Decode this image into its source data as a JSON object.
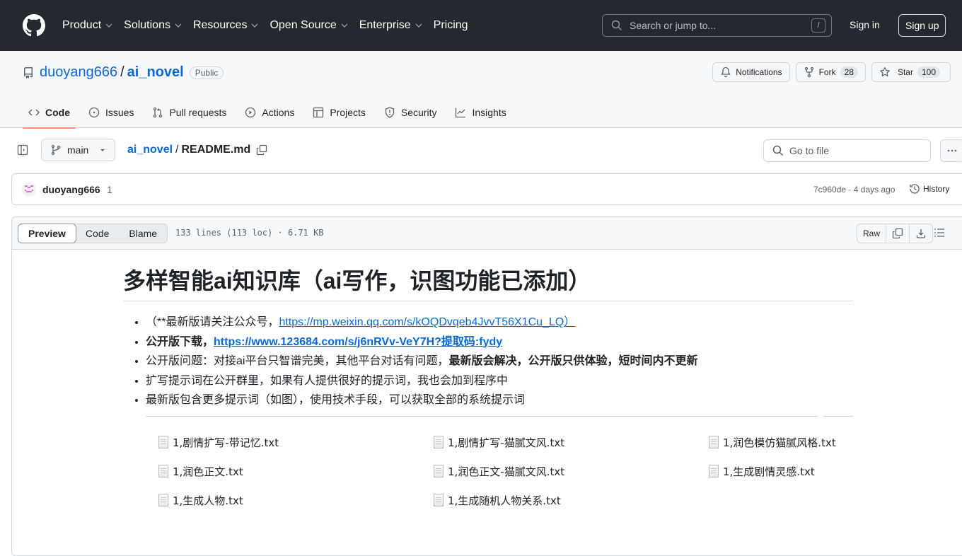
{
  "header": {
    "nav": [
      "Product",
      "Solutions",
      "Resources",
      "Open Source",
      "Enterprise",
      "Pricing"
    ],
    "nav_has_dropdown": [
      true,
      true,
      true,
      true,
      true,
      false
    ],
    "search_placeholder": "Search or jump to...",
    "search_shortcut": "/",
    "sign_in": "Sign in",
    "sign_up": "Sign up"
  },
  "repo": {
    "owner": "duoyang666",
    "separator": "/",
    "name": "ai_novel",
    "visibility": "Public",
    "notifications_label": "Notifications",
    "fork_label": "Fork",
    "fork_count": "28",
    "star_label": "Star",
    "star_count": "100",
    "tabs": [
      {
        "label": "Code",
        "icon": "code-icon",
        "active": true
      },
      {
        "label": "Issues",
        "icon": "issue-icon"
      },
      {
        "label": "Pull requests",
        "icon": "pull-request-icon"
      },
      {
        "label": "Actions",
        "icon": "play-icon"
      },
      {
        "label": "Projects",
        "icon": "table-icon"
      },
      {
        "label": "Security",
        "icon": "shield-icon"
      },
      {
        "label": "Insights",
        "icon": "graph-icon"
      }
    ]
  },
  "file_nav": {
    "branch": "main",
    "crumb_repo": "ai_novel",
    "crumb_sep": "/",
    "crumb_file": "README.md",
    "goto_placeholder": "Go to file"
  },
  "commit": {
    "author": "duoyang666",
    "count": "1",
    "meta": "7c960de · 4 days ago",
    "history": "History"
  },
  "file": {
    "view_tabs": [
      "Preview",
      "Code",
      "Blame"
    ],
    "active_view": "Preview",
    "info": "133 lines (113 loc) · 6.71 KB",
    "raw": "Raw"
  },
  "readme": {
    "title": "多样智能ai知识库（ai写作，识图功能已添加）",
    "items": [
      {
        "prefix": "（**最新版请关注公众号，",
        "link": "https://mp.weixin.qq.com/s/kOQDvqeb4JvvT56X1Cu_LQ）",
        "bold": false
      },
      {
        "prefix": "公开版下载，",
        "link": "https://www.123684.com/s/j6nRVv-VeY7H?提取码:fydy",
        "bold": true
      },
      {
        "prefix": "公开版问题：对接ai平台只智谱完美，其他平台对话有问题，",
        "suffix_bold": "最新版会解决，公开版只供体验，短时间内不更新"
      },
      {
        "prefix": "扩写提示词在公开群里，如果有人提供很好的提示词，我也会加到程序中"
      },
      {
        "prefix": "最新版包含更多提示词（如图），使用技术手段，可以获取全部的系统提示词"
      }
    ],
    "image_files": [
      "1,剧情扩写-带记忆.txt",
      "1,剧情扩写-猫腻文风.txt",
      "1,润色模仿猫腻风格.txt",
      "1,润色正文.txt",
      "1,润色正文-猫腻文风.txt",
      "1,生成剧情灵感.txt",
      "1,生成人物.txt",
      "1,生成随机人物关系.txt"
    ]
  }
}
